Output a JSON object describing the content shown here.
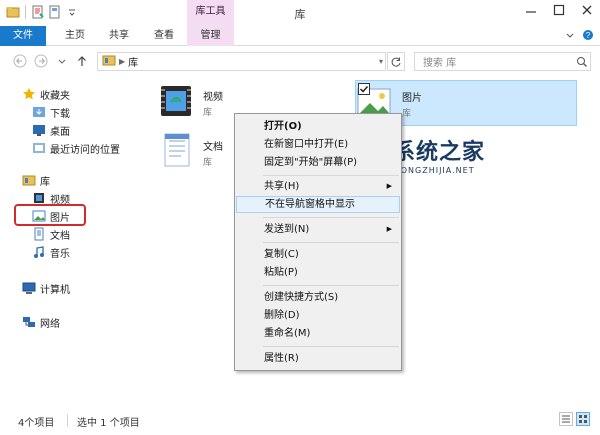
{
  "window": {
    "title": "库",
    "contextual_tab_group": "库工具"
  },
  "ribbon": {
    "tabs": [
      "文件",
      "主页",
      "共享",
      "查看",
      "管理"
    ]
  },
  "address": {
    "path": "库"
  },
  "search": {
    "placeholder": "搜索 库"
  },
  "nav": {
    "favorites": "收藏夹",
    "favorites_items": [
      "下载",
      "桌面",
      "最近访问的位置"
    ],
    "libraries": "库",
    "library_items": [
      "视频",
      "图片",
      "文档",
      "音乐"
    ],
    "computer": "计算机",
    "network": "网络"
  },
  "content": {
    "items": [
      {
        "name": "视频",
        "sub": "库"
      },
      {
        "name": "文档",
        "sub": "库"
      },
      {
        "name": "图片",
        "sub": "库"
      }
    ]
  },
  "context_menu": {
    "items": [
      "打开(O)",
      "在新窗口中打开(E)",
      "固定到\"开始\"屏幕(P)",
      "共享(H)",
      "不在导航窗格中显示",
      "发送到(N)",
      "复制(C)",
      "粘贴(P)",
      "创建快捷方式(S)",
      "删除(D)",
      "重命名(M)",
      "属性(R)"
    ]
  },
  "watermark": {
    "title": "系统之家",
    "subtitle": "XITONGZHIJIA.NET"
  },
  "status": {
    "item_count": "4个项目",
    "selected": "选中 1 个项目"
  },
  "colors": {
    "file_tab": "#1979ca",
    "contextual_tab": "#f4dcf3",
    "selection": "#cce8ff",
    "highlight_box": "#d02c2c"
  }
}
